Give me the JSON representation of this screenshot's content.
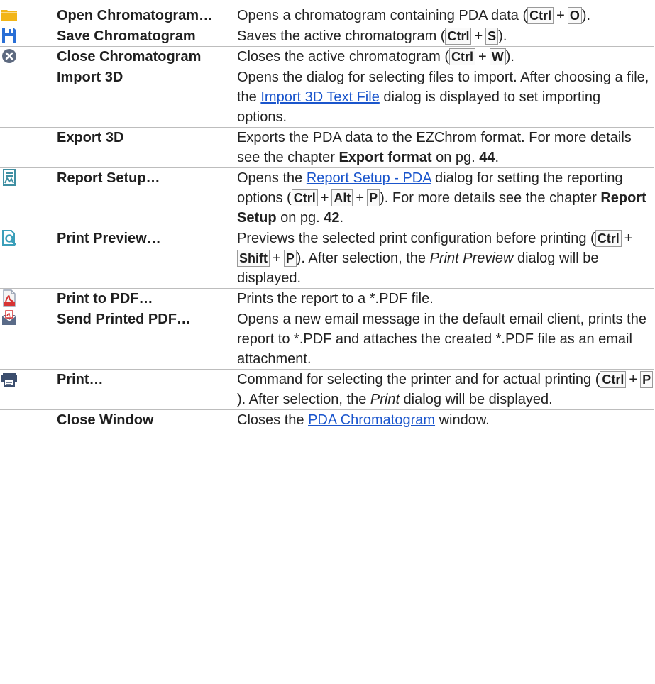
{
  "rows": [
    {
      "icon": "folder-icon",
      "name": "Open Chromatogram…",
      "desc": [
        {
          "t": "Opens a chromatogram containing PDA data ("
        },
        {
          "k": "Ctrl"
        },
        {
          "t": "+"
        },
        {
          "k": "O"
        },
        {
          "t": ")."
        }
      ]
    },
    {
      "icon": "save-icon",
      "name": "Save Chromatogram",
      "desc": [
        {
          "t": "Saves the active chromatogram ("
        },
        {
          "k": "Ctrl"
        },
        {
          "t": "+"
        },
        {
          "k": "S"
        },
        {
          "t": ")."
        }
      ]
    },
    {
      "icon": "close-circle-icon",
      "name": "Close Chromatogram",
      "desc": [
        {
          "t": "Closes the active chromatogram ("
        },
        {
          "k": "Ctrl"
        },
        {
          "t": "+"
        },
        {
          "k": "W"
        },
        {
          "t": ")."
        }
      ]
    },
    {
      "icon": "",
      "name": "Import 3D",
      "desc": [
        {
          "t": "Opens the dialog for selecting files to import. After choosing a file, the "
        },
        {
          "l": "Import 3D Text File"
        },
        {
          "t": " dialog is displayed to set importing options."
        }
      ]
    },
    {
      "icon": "",
      "name": "Export 3D",
      "desc": [
        {
          "t": "Exports the PDA data to the EZChrom format. For more details see the chapter "
        },
        {
          "b": "Export format"
        },
        {
          "t": " on pg. "
        },
        {
          "b": "44"
        },
        {
          "t": "."
        }
      ]
    },
    {
      "icon": "report-setup-icon",
      "name": "Report Setup…",
      "desc": [
        {
          "t": "Opens the "
        },
        {
          "l": "Report Setup - PDA"
        },
        {
          "t": " dialog for setting the reporting options ("
        },
        {
          "k": "Ctrl"
        },
        {
          "t": "+"
        },
        {
          "k": "Alt"
        },
        {
          "t": "+"
        },
        {
          "k": "P"
        },
        {
          "t": "). For more details see the chapter "
        },
        {
          "b": "Report Setup"
        },
        {
          "t": " on pg. "
        },
        {
          "b": "42"
        },
        {
          "t": "."
        }
      ]
    },
    {
      "icon": "print-preview-icon",
      "name": "Print Preview…",
      "desc": [
        {
          "t": "Previews the selected print configuration before printing ("
        },
        {
          "k": "Ctrl"
        },
        {
          "t": "+"
        },
        {
          "k": "Shift"
        },
        {
          "t": "+"
        },
        {
          "k": "P"
        },
        {
          "t": "). After selection, the "
        },
        {
          "i": "Print Preview"
        },
        {
          "t": " dialog will be displayed."
        }
      ]
    },
    {
      "icon": "pdf-icon",
      "name": "Print to PDF…",
      "desc": [
        {
          "t": "Prints the report to a *.PDF file."
        }
      ]
    },
    {
      "icon": "send-pdf-icon",
      "name": "Send Printed PDF…",
      "desc": [
        {
          "t": "Opens a new email message in the default email client, prints the report to *.PDF and attaches the created *.PDF file as an email attachment."
        }
      ]
    },
    {
      "icon": "printer-icon",
      "name": "Print…",
      "desc": [
        {
          "t": "Command for selecting the printer and for actual printing ("
        },
        {
          "k": "Ctrl"
        },
        {
          "t": "+"
        },
        {
          "k": "P"
        },
        {
          "t": "). After selection, the "
        },
        {
          "i": "Print"
        },
        {
          "t": " dialog will be displayed."
        }
      ]
    },
    {
      "icon": "",
      "name": "Close Window",
      "desc": [
        {
          "t": "Closes the "
        },
        {
          "l": "PDA Chromatogram"
        },
        {
          "t": " window."
        }
      ]
    }
  ],
  "colors": {
    "link": "#1a55cc",
    "rule": "#bdbdbd",
    "folder": "#f2b517",
    "save": "#2a6fd6",
    "close": "#5e6a80",
    "report": "#3f8fa2",
    "preview": "#3b9fba",
    "pdf": "#d63333",
    "printer": "#3c4e6e"
  }
}
